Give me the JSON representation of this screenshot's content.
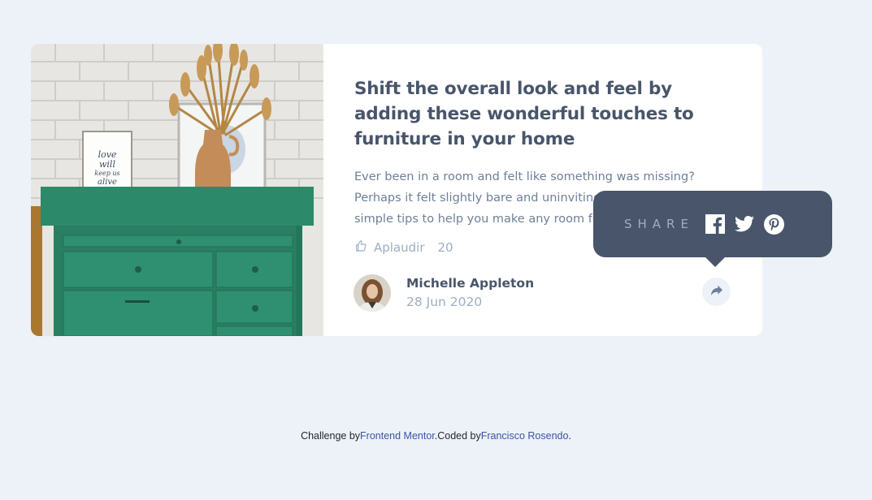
{
  "article": {
    "title": "Shift the overall look and feel by adding these wonderful touches to furniture in your home",
    "excerpt": "Ever been in a room and felt like something was missing? Perhaps it felt slightly bare and uninviting. I’ve got some simple tips to help you make any room feel complete.",
    "applaud_label": "Aplaudir",
    "applaud_count": "20",
    "image_alt": "green drawer"
  },
  "author": {
    "name": "Michelle Appleton",
    "date": "28 Jun 2020"
  },
  "share": {
    "label": "SHARE",
    "icons": [
      "facebook-icon",
      "twitter-icon",
      "pinterest-icon"
    ],
    "button_icon": "share-arrow-icon"
  },
  "footer": {
    "prefix": "Challenge by",
    "challenge_link": "Frontend Mentor",
    "middle": ".Coded by",
    "coder_link": "Francisco Rosendo",
    "suffix": "."
  },
  "colors": {
    "background": "#ECF2F8",
    "dark_blue": "#48556A",
    "grayish_blue": "#6E8098",
    "light_grayish_blue": "#9EAFC2",
    "link": "#3E52A3"
  }
}
